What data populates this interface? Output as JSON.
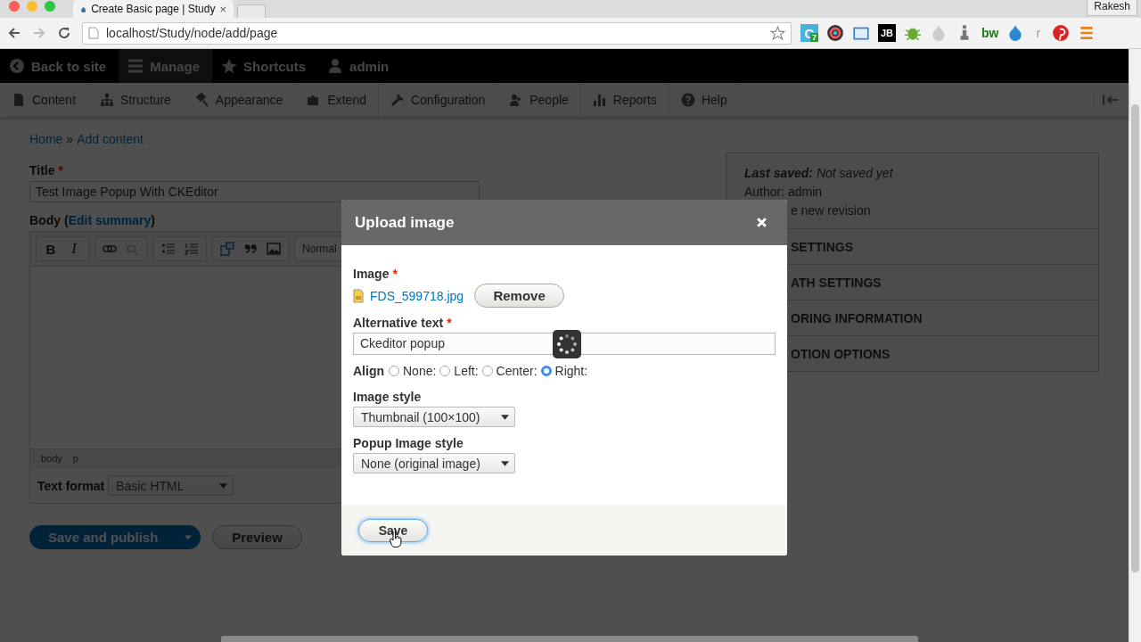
{
  "browser": {
    "tab_title": "Create Basic page | Study",
    "tab_close": "×",
    "profile": "Rakesh",
    "url": "localhost/Study/node/add/page",
    "extensions": [
      {
        "kind": "c-badge",
        "text": "C",
        "badge": "7"
      },
      {
        "kind": "lens"
      },
      {
        "kind": "window"
      },
      {
        "kind": "jb",
        "text": "JB"
      },
      {
        "kind": "bug"
      },
      {
        "kind": "drop-grey"
      },
      {
        "kind": "figure"
      },
      {
        "kind": "text-green",
        "text": "bw"
      },
      {
        "kind": "drop"
      },
      {
        "kind": "text-grey",
        "text": "r"
      },
      {
        "kind": "pin"
      }
    ]
  },
  "toolbar": {
    "items": [
      {
        "label": "Back to site",
        "kind": "back",
        "selected": false
      },
      {
        "label": "Manage",
        "kind": "menu",
        "selected": true
      },
      {
        "label": "Shortcuts",
        "kind": "star",
        "selected": false
      },
      {
        "label": "admin",
        "kind": "user",
        "selected": false
      }
    ]
  },
  "admin_menu": {
    "items": [
      {
        "label": "Content",
        "kind": "page"
      },
      {
        "label": "Structure",
        "kind": "tree"
      },
      {
        "label": "Appearance",
        "kind": "brush"
      },
      {
        "label": "Extend",
        "kind": "puzzle"
      },
      {
        "label": "Configuration",
        "kind": "wrench"
      },
      {
        "label": "People",
        "kind": "people"
      },
      {
        "label": "Reports",
        "kind": "bars"
      },
      {
        "label": "Help",
        "kind": "help"
      }
    ]
  },
  "breadcrumb": {
    "items": [
      "Home",
      "Add content"
    ],
    "separator": "»"
  },
  "form": {
    "title_label": "Title",
    "required": "*",
    "title_value": "Test Image Popup  With CKEditor",
    "body_label": "Body",
    "summary_open": "(",
    "summary_link": "Edit summary",
    "summary_close": ")",
    "editor_buttons": [
      {
        "kind": "bold",
        "text": "B"
      },
      {
        "kind": "italic",
        "text": "I"
      },
      {
        "kind": "link"
      },
      {
        "kind": "unlink"
      },
      {
        "kind": "bullets"
      },
      {
        "kind": "numbers"
      },
      {
        "kind": "embed"
      },
      {
        "kind": "quote"
      },
      {
        "kind": "image"
      }
    ],
    "format_select": "Normal",
    "path": [
      "body",
      "p"
    ],
    "text_format_label": "Text format",
    "text_format_value": "Basic HTML",
    "save_button": "Save and publish",
    "preview_button": "Preview"
  },
  "sidebar": {
    "last_saved": "**Last saved:** Not saved yet",
    "author": "Author: admin",
    "revision": "e new revision",
    "sections": [
      "SETTINGS",
      "ATH SETTINGS",
      "ORING INFORMATION",
      "OTION OPTIONS"
    ]
  },
  "dialog": {
    "title": "Upload image",
    "image_label": "Image",
    "required": "*",
    "file_name": "FDS_599718.jpg",
    "remove_button": "Remove",
    "alt_label": "Alternative text",
    "alt_value": "Ckeditor popup",
    "align_label": "Align",
    "align_options": [
      {
        "label": "None:",
        "selected": false
      },
      {
        "label": "Left:",
        "selected": false
      },
      {
        "label": "Center:",
        "selected": false
      },
      {
        "label": "Right:",
        "selected": true
      }
    ],
    "image_style_label": "Image style",
    "image_style_value": "Thumbnail (100×100)",
    "popup_style_label": "Popup Image style",
    "popup_style_value": "None (original image)",
    "save_button": "Save"
  }
}
